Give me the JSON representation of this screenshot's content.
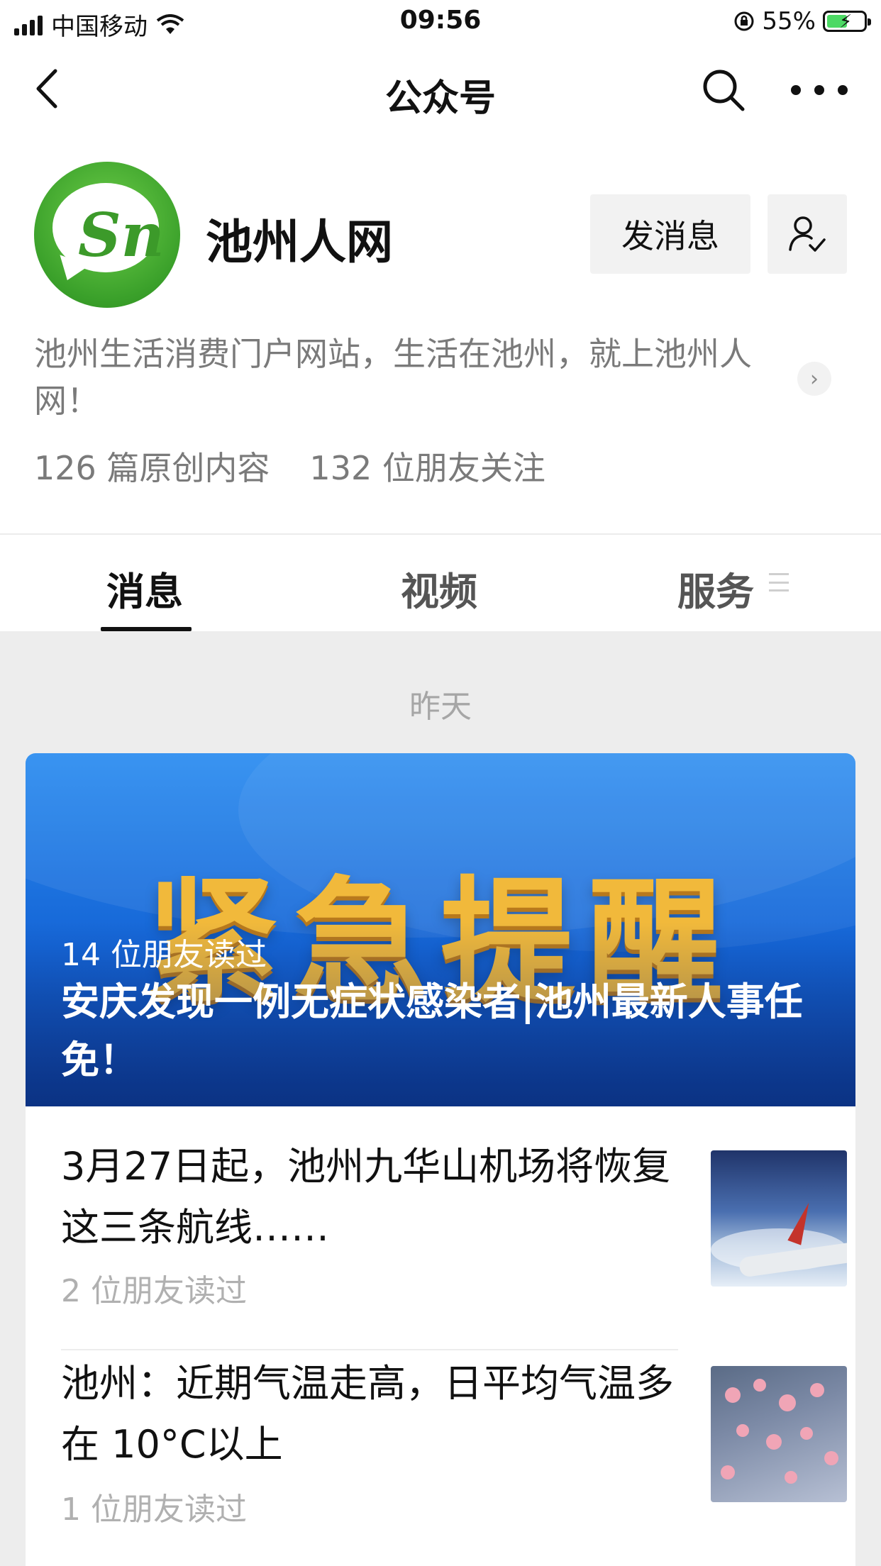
{
  "status_bar": {
    "carrier": "中国移动",
    "time": "09:56",
    "battery_percent": "55%",
    "battery_level": 0.55,
    "icons": [
      "signal-icon",
      "wifi-icon",
      "rotation-lock-icon",
      "battery-charging-icon"
    ]
  },
  "nav": {
    "title": "公众号",
    "back_icon": "chevron-left-icon",
    "search_icon": "search-icon",
    "more_icon": "more-icon"
  },
  "profile": {
    "name": "池州人网",
    "message_button": "发消息",
    "follow_icon": "person-check-icon",
    "description": "池州生活消费门户网站，生活在池州，就上池州人网！",
    "original_count": "126 篇原创内容",
    "followers": "132 位朋友关注"
  },
  "tabs": [
    {
      "label": "消息",
      "active": true
    },
    {
      "label": "视频",
      "active": false
    },
    {
      "label": "服务",
      "active": false
    }
  ],
  "feed": {
    "date_label": "昨天",
    "hero": {
      "banner_text": "紧急提醒",
      "reads": "14 位朋友读过",
      "title": "安庆发现一例无症状感染者|池州最新人事任免！"
    },
    "articles": [
      {
        "title": "3月27日起，池州九华山机场将恢复这三条航线……",
        "reads": "2 位朋友读过",
        "thumb": "airplane-wing-photo"
      },
      {
        "title": "池州：近期气温走高，日平均气温多在 10°C以上",
        "reads": "1 位朋友读过",
        "thumb": "plum-blossom-photo"
      }
    ]
  },
  "colors": {
    "accent_green": "#3aa02a",
    "hero_blue": "#1565d6",
    "banner_gold": "#f1b93b",
    "muted_text": "#7a7a7a",
    "feed_bg": "#ededed"
  }
}
